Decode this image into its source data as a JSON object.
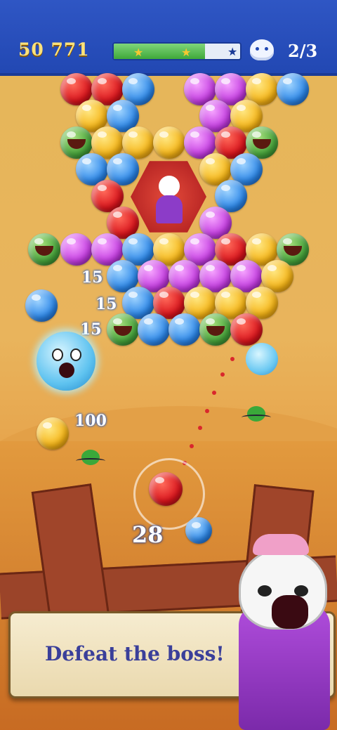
{
  "hud": {
    "score": "50 771",
    "progress_fraction": 0.72,
    "ghosts_rescued": "2/3"
  },
  "game": {
    "popup_scores": [
      "15",
      "15",
      "15",
      "100"
    ],
    "moves_left": "28"
  },
  "banner": {
    "text": "Defeat the boss!"
  }
}
